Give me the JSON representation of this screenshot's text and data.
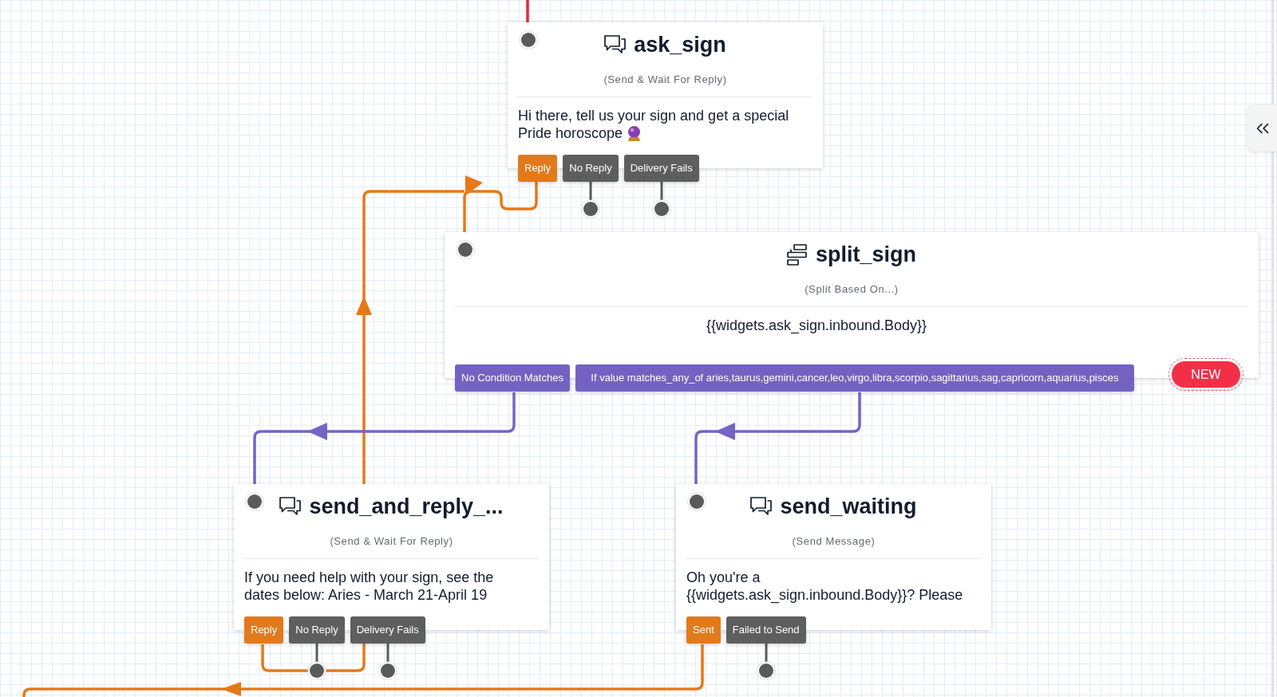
{
  "canvas": {
    "nodes": [
      {
        "kind": "send_and_wait",
        "title": "ask_sign",
        "subtitle": "(Send & Wait For Reply)",
        "body": [
          "Hi there, tell us your sign and get a special",
          "Pride horoscope"
        ],
        "trailing_emoji": true,
        "transitions": [
          {
            "label": "Reply",
            "color": "#e27a1c",
            "connected": true
          },
          {
            "label": "No Reply",
            "color": "#5e5e5e",
            "connected": false
          },
          {
            "label": "Delivery Fails",
            "color": "#5e5e5e",
            "connected": false
          }
        ]
      },
      {
        "kind": "split",
        "title": "split_sign",
        "subtitle": "(Split Based On...)",
        "body": [
          "{{widgets.ask_sign.inbound.Body}}"
        ],
        "transitions": [
          {
            "label": "No Condition Matches",
            "color": "#7462c2",
            "connected": true
          },
          {
            "label": "If value matches_any_of aries,taurus,gemini,cancer,leo,virgo,libra,scorpio,sagittarius,sag,capricorn,aquarius,pisces",
            "color": "#7462c2",
            "connected": true
          }
        ],
        "new_button": "NEW"
      },
      {
        "kind": "send_and_wait",
        "title": "send_and_reply_...",
        "subtitle": "(Send & Wait For Reply)",
        "body": [
          "If you need help with your sign, see the",
          "dates below: Aries - March 21-April 19"
        ],
        "transitions": [
          {
            "label": "Reply",
            "color": "#e27a1c",
            "connected": true
          },
          {
            "label": "No Reply",
            "color": "#5e5e5e",
            "connected": false
          },
          {
            "label": "Delivery Fails",
            "color": "#5e5e5e",
            "connected": false
          }
        ]
      },
      {
        "kind": "send_message",
        "title": "send_waiting",
        "subtitle": "(Send Message)",
        "body": [
          "Oh you're a",
          "{{widgets.ask_sign.inbound.Body}}? Please"
        ],
        "transitions": [
          {
            "label": "Sent",
            "color": "#e27a1c",
            "connected": true
          },
          {
            "label": "Failed to Send",
            "color": "#5e5e5e",
            "connected": false
          }
        ]
      }
    ]
  }
}
